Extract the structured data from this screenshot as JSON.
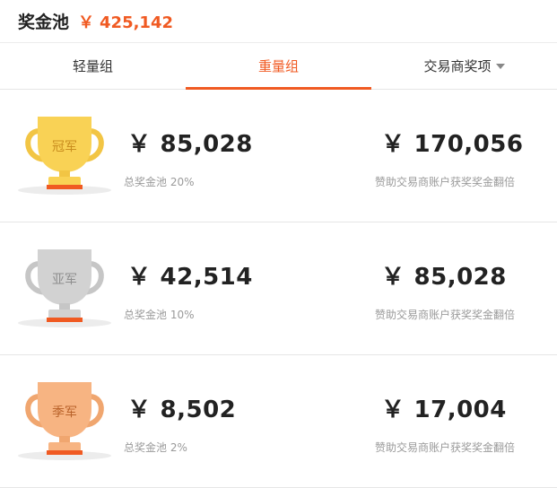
{
  "header": {
    "title": "奖金池",
    "currency": "￥",
    "pool_amount": "425,142"
  },
  "tabs": [
    {
      "label": "轻量组",
      "active": false
    },
    {
      "label": "重量组",
      "active": true
    },
    {
      "label": "交易商奖项",
      "active": false,
      "has_dropdown": true
    }
  ],
  "prizes": [
    {
      "rank": "冠军",
      "trophy_color": "#f9d255",
      "amount_currency": "￥",
      "amount": "85,028",
      "amount_note": "总奖金池 20%",
      "bonus_currency": "￥",
      "bonus_amount": "170,056",
      "bonus_note": "赞助交易商账户获奖奖金翻倍"
    },
    {
      "rank": "亚军",
      "trophy_color": "#d2d2d2",
      "amount_currency": "￥",
      "amount": "42,514",
      "amount_note": "总奖金池 10%",
      "bonus_currency": "￥",
      "bonus_amount": "85,028",
      "bonus_note": "赞助交易商账户获奖奖金翻倍"
    },
    {
      "rank": "季军",
      "trophy_color": "#f7b482",
      "amount_currency": "￥",
      "amount": "8,502",
      "amount_note": "总奖金池 2%",
      "bonus_currency": "￥",
      "bonus_amount": "17,004",
      "bonus_note": "赞助交易商账户获奖奖金翻倍"
    }
  ],
  "colors": {
    "accent": "#f05a22",
    "gold": "#f9d255",
    "silver": "#d2d2d2",
    "bronze": "#f7b482",
    "base_bar": "#f05a22"
  }
}
